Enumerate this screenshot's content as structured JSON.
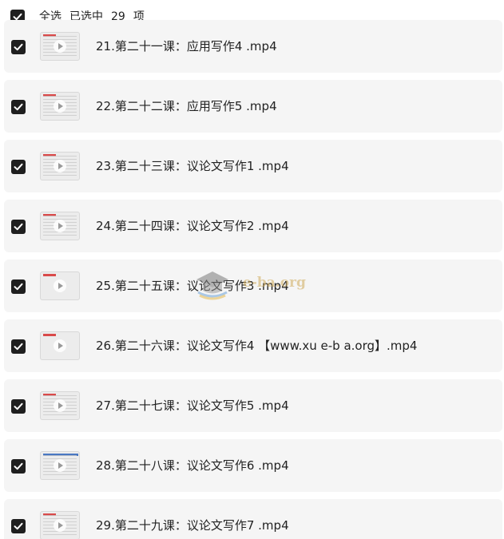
{
  "header": {
    "select_all_label": "全选",
    "selected_label": "已选中",
    "selected_count": "29",
    "unit_label": "项",
    "checked": true
  },
  "items": [
    {
      "title": "21.第二十一课：应用写作4 .mp4",
      "checked": true,
      "thumb": "doc"
    },
    {
      "title": "22.第二十二课：应用写作5 .mp4",
      "checked": true,
      "thumb": "doc"
    },
    {
      "title": "23.第二十三课：议论文写作1 .mp4",
      "checked": true,
      "thumb": "doc"
    },
    {
      "title": "24.第二十四课：议论文写作2 .mp4",
      "checked": true,
      "thumb": "doc"
    },
    {
      "title": "25.第二十五课：议论文写作3 .mp4",
      "checked": true,
      "thumb": "blank"
    },
    {
      "title": "26.第二十六课：议论文写作4 【www.xu e-b a.org】.mp4",
      "checked": true,
      "thumb": "blank"
    },
    {
      "title": "27.第二十七课：议论文写作5 .mp4",
      "checked": true,
      "thumb": "doc"
    },
    {
      "title": "28.第二十八课：议论文写作6 .mp4",
      "checked": true,
      "thumb": "blue"
    },
    {
      "title": "29.第二十九课：议论文写作7 .mp4",
      "checked": true,
      "thumb": "doc"
    }
  ],
  "watermark": {
    "icon": "graduation-cap-icon",
    "text": "e-ba.org"
  },
  "colors": {
    "checkbox": "#1f1f1f",
    "row_background": "#f5f5f5",
    "text": "#222222"
  }
}
